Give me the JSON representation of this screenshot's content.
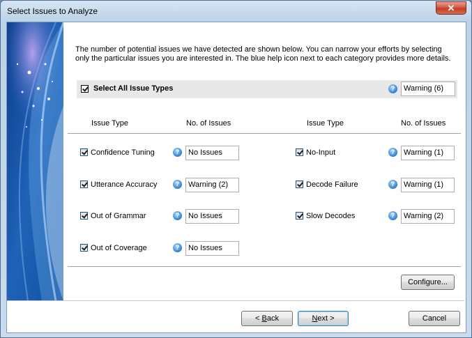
{
  "window": {
    "title": "Select Issues to Analyze",
    "close_glyph": "✕"
  },
  "intro": "The number of potential issues we have detected are shown below. You can narrow your efforts by selecting only the particular issues you are interested in. The blue help icon next to each category provides more details.",
  "select_all": {
    "label": "Select All Issue Types",
    "checked": true,
    "status": "Warning (6)"
  },
  "columns": {
    "issue_type": "Issue Type",
    "no_of_issues": "No. of Issues"
  },
  "issues_left": [
    {
      "label": "Confidence Tuning",
      "checked": true,
      "value": "No Issues"
    },
    {
      "label": "Utterance Accuracy",
      "checked": true,
      "value": "Warning (2)"
    },
    {
      "label": "Out of Grammar",
      "checked": true,
      "value": "No Issues"
    },
    {
      "label": "Out of Coverage",
      "checked": true,
      "value": "No Issues"
    }
  ],
  "issues_right": [
    {
      "label": "No-Input",
      "checked": true,
      "value": "Warning (1)"
    },
    {
      "label": "Decode Failure",
      "checked": true,
      "value": "Warning (1)"
    },
    {
      "label": "Slow Decodes",
      "checked": true,
      "value": "Warning (2)"
    }
  ],
  "buttons": {
    "configure": "Configure...",
    "back_prefix": "< ",
    "back_mnemonic": "B",
    "back_rest": "ack",
    "next_mnemonic": "N",
    "next_rest": "ext >",
    "cancel": "Cancel"
  },
  "icons": {
    "help": "help-question-icon"
  },
  "colors": {
    "side_panel_blue": "#1f63b8",
    "help_icon_blue": "#2f7fd0"
  }
}
